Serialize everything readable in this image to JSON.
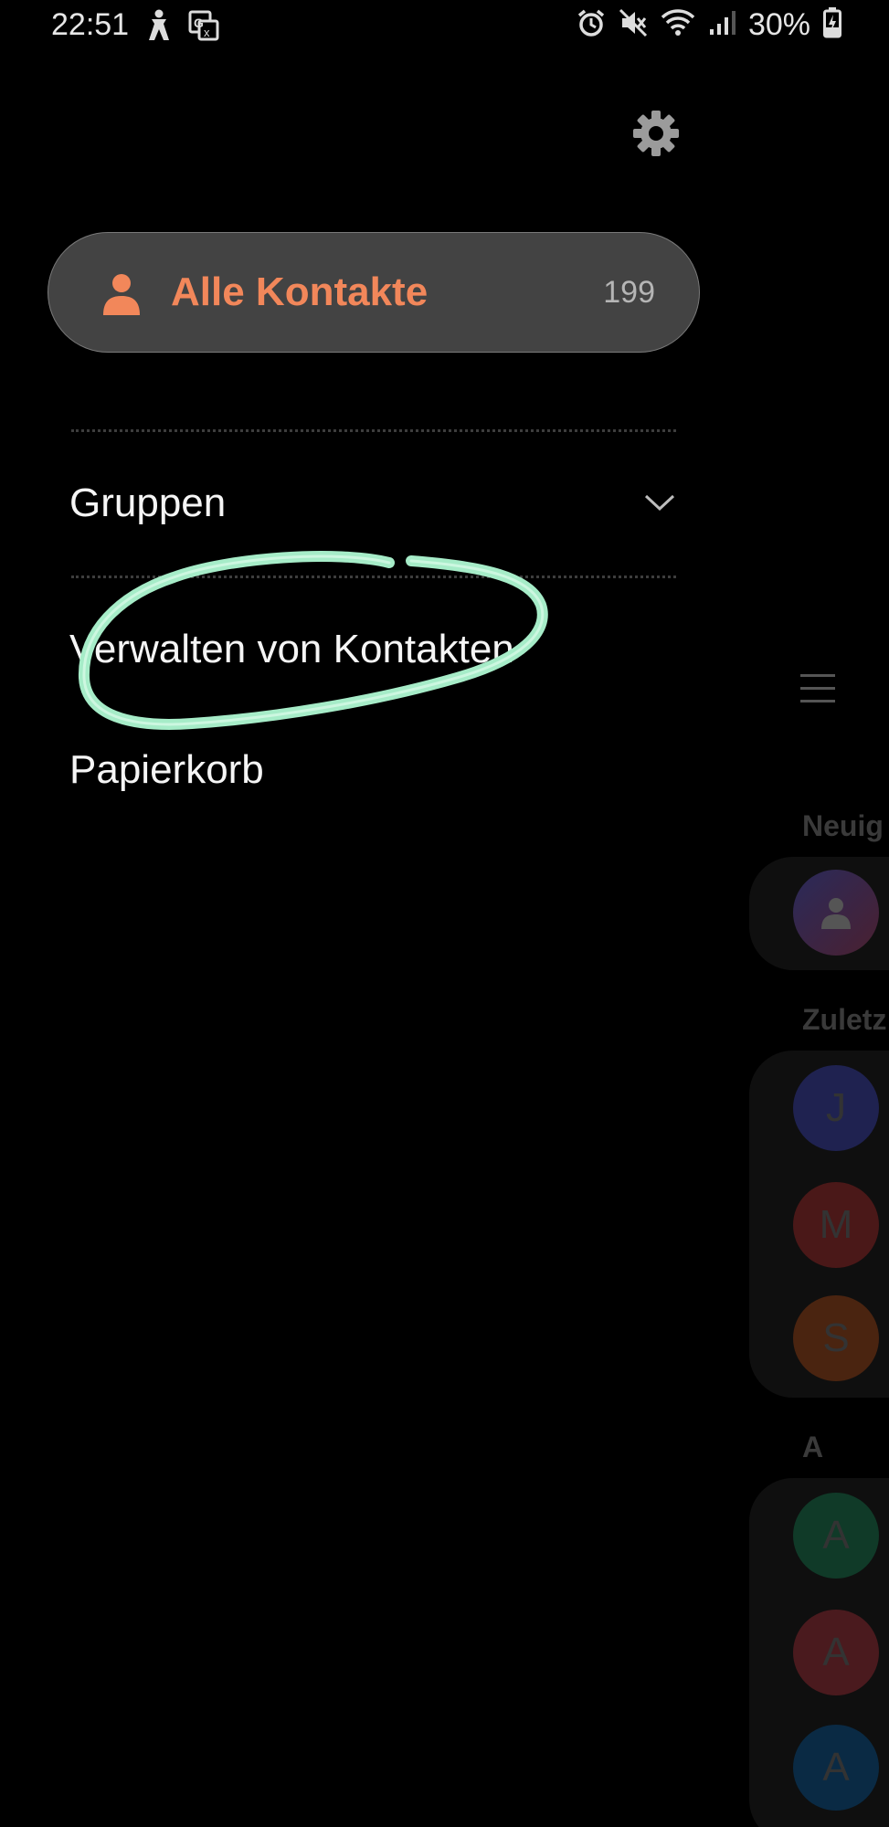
{
  "status_bar": {
    "time": "22:51",
    "battery": "30%",
    "left_icons": [
      "accessibility-icon",
      "translate-icon"
    ],
    "right_icons": [
      "alarm-icon",
      "mute-icon",
      "wifi-icon",
      "signal-icon",
      "battery-charging-icon"
    ]
  },
  "drawer": {
    "all_contacts": {
      "label": "Alle Kontakte",
      "count": "199"
    },
    "groups_label": "Gruppen",
    "manage_label": "Verwalten von Kontakten",
    "trash_label": "Papierkorb"
  },
  "background_list": {
    "section_new": "Neuig",
    "section_recent": "Zuletz",
    "section_a": "A",
    "recent_avatars": [
      "J",
      "M",
      "S"
    ],
    "a_avatars": [
      "A",
      "A",
      "A"
    ]
  },
  "colors": {
    "accent": "#f2875a",
    "highlight": "#9ee8c4",
    "pill_bg": "#434343"
  }
}
